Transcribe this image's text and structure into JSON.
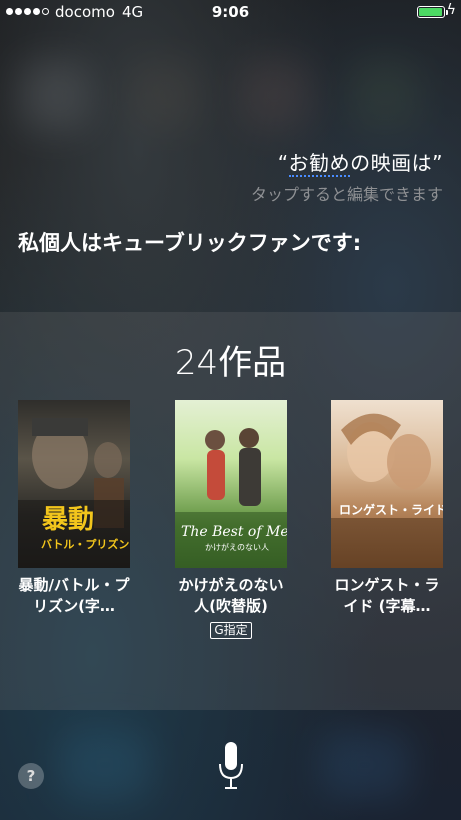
{
  "status_bar": {
    "carrier": "docomo",
    "network": "4G",
    "time": "9:06",
    "signal_bars": 4,
    "signal_total": 5,
    "battery_level": 0.95
  },
  "siri": {
    "query_prefix": "“",
    "query_highlight": "お勧め",
    "query_rest": "の映画は”",
    "tap_to_edit": "タップすると編集できます",
    "response": "私個人はキューブリックファンです:"
  },
  "results": {
    "count_label": "24作品",
    "movies": [
      {
        "title": "暴動/バトル・プリズン(字…",
        "poster_text": "暴動",
        "poster_sub": "バトル・プリズン",
        "rating": ""
      },
      {
        "title": "かけがえのない人(吹替版)",
        "poster_text": "The Best of Me",
        "poster_sub": "かけがえのない人",
        "rating": "G指定"
      },
      {
        "title": "ロンゲスト・ライド (字幕…",
        "poster_text": "ロンゲスト・ライド",
        "poster_sub": "",
        "rating": ""
      }
    ]
  },
  "footer": {
    "help_label": "?"
  },
  "icons": {
    "microphone": "microphone-icon",
    "help": "help-icon",
    "charging": "charging-bolt-icon"
  },
  "colors": {
    "accent_underline": "#4a8cff",
    "battery": "#4cd964"
  }
}
